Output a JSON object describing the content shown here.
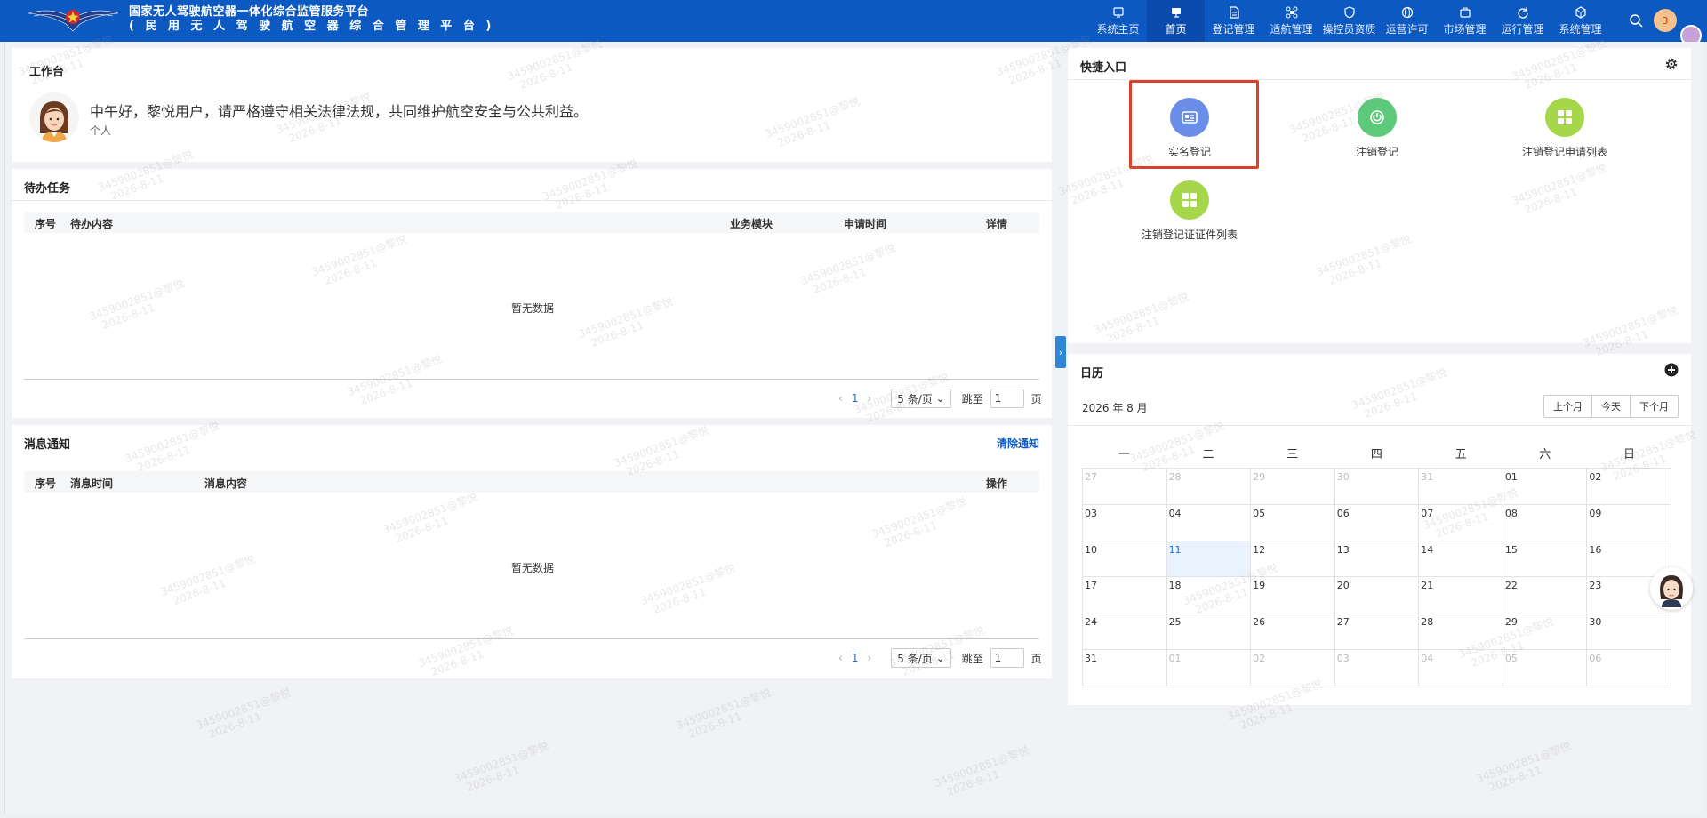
{
  "header": {
    "title_line1": "国家无人驾驶航空器一体化综合监管服务平台",
    "title_line2": "( 民 用 无 人 驾 驶 航 空 器 综 合 管 理 平 台 )",
    "nav": [
      {
        "label": "系统主页",
        "icon": "monitor-icon"
      },
      {
        "label": "首页",
        "icon": "desktop-icon"
      },
      {
        "label": "登记管理",
        "icon": "document-icon"
      },
      {
        "label": "适航管理",
        "icon": "drone-icon"
      },
      {
        "label": "操控员资质",
        "icon": "shield-icon"
      },
      {
        "label": "运营许可",
        "icon": "globe-icon"
      },
      {
        "label": "市场管理",
        "icon": "briefcase-icon"
      },
      {
        "label": "运行管理",
        "icon": "refresh-icon"
      },
      {
        "label": "系统管理",
        "icon": "cube-icon"
      }
    ],
    "active_nav": "首页",
    "notification_count": "3"
  },
  "workbench": {
    "title": "工作台",
    "greeting": "中午好，黎悦用户，请严格遵守相关法律法规，共同维护航空安全与公共利益。",
    "role": "个人"
  },
  "tasks": {
    "title": "待办任务",
    "columns": [
      "序号",
      "待办内容",
      "业务模块",
      "申请时间",
      "详情"
    ],
    "empty": "暂无数据",
    "pager": {
      "page": "1",
      "page_size": "5 条/页",
      "jump_label": "跳至",
      "jump_value": "1",
      "page_label": "页",
      "prev": "‹",
      "next": "›"
    }
  },
  "messages": {
    "title": "消息通知",
    "clear_label": "清除通知",
    "columns": [
      "序号",
      "消息时间",
      "消息内容",
      "操作"
    ],
    "empty": "暂无数据",
    "pager": {
      "page": "1",
      "page_size": "5 条/页",
      "jump_label": "跳至",
      "jump_value": "1",
      "page_label": "页",
      "prev": "‹",
      "next": "›"
    }
  },
  "quick_entry": {
    "title": "快捷入口",
    "items": [
      {
        "label": "实名登记",
        "color": "#6a8ee8",
        "icon": "id-card-icon"
      },
      {
        "label": "注销登记",
        "color": "#5dc97a",
        "icon": "power-icon"
      },
      {
        "label": "注销登记申请列表",
        "color": "#a6d64a",
        "icon": "grid-icon"
      },
      {
        "label": "注销登记证证件列表",
        "color": "#a6d64a",
        "icon": "grid-icon"
      }
    ]
  },
  "calendar": {
    "title": "日历",
    "month_label": "2026 年 8 月",
    "buttons": [
      "上个月",
      "今天",
      "下个月"
    ],
    "weekdays": [
      "一",
      "二",
      "三",
      "四",
      "五",
      "六",
      "日"
    ],
    "days": [
      [
        "27",
        "28",
        "29",
        "30",
        "31",
        "01",
        "02"
      ],
      [
        "03",
        "04",
        "05",
        "06",
        "07",
        "08",
        "09"
      ],
      [
        "10",
        "11",
        "12",
        "13",
        "14",
        "15",
        "16"
      ],
      [
        "17",
        "18",
        "19",
        "20",
        "21",
        "22",
        "23"
      ],
      [
        "24",
        "25",
        "26",
        "27",
        "28",
        "29",
        "30"
      ],
      [
        "31",
        "01",
        "02",
        "03",
        "04",
        "05",
        "06"
      ]
    ],
    "today": "11"
  },
  "watermark": {
    "line1": "3459002851@黎悦",
    "line2": "2026-8-11"
  }
}
